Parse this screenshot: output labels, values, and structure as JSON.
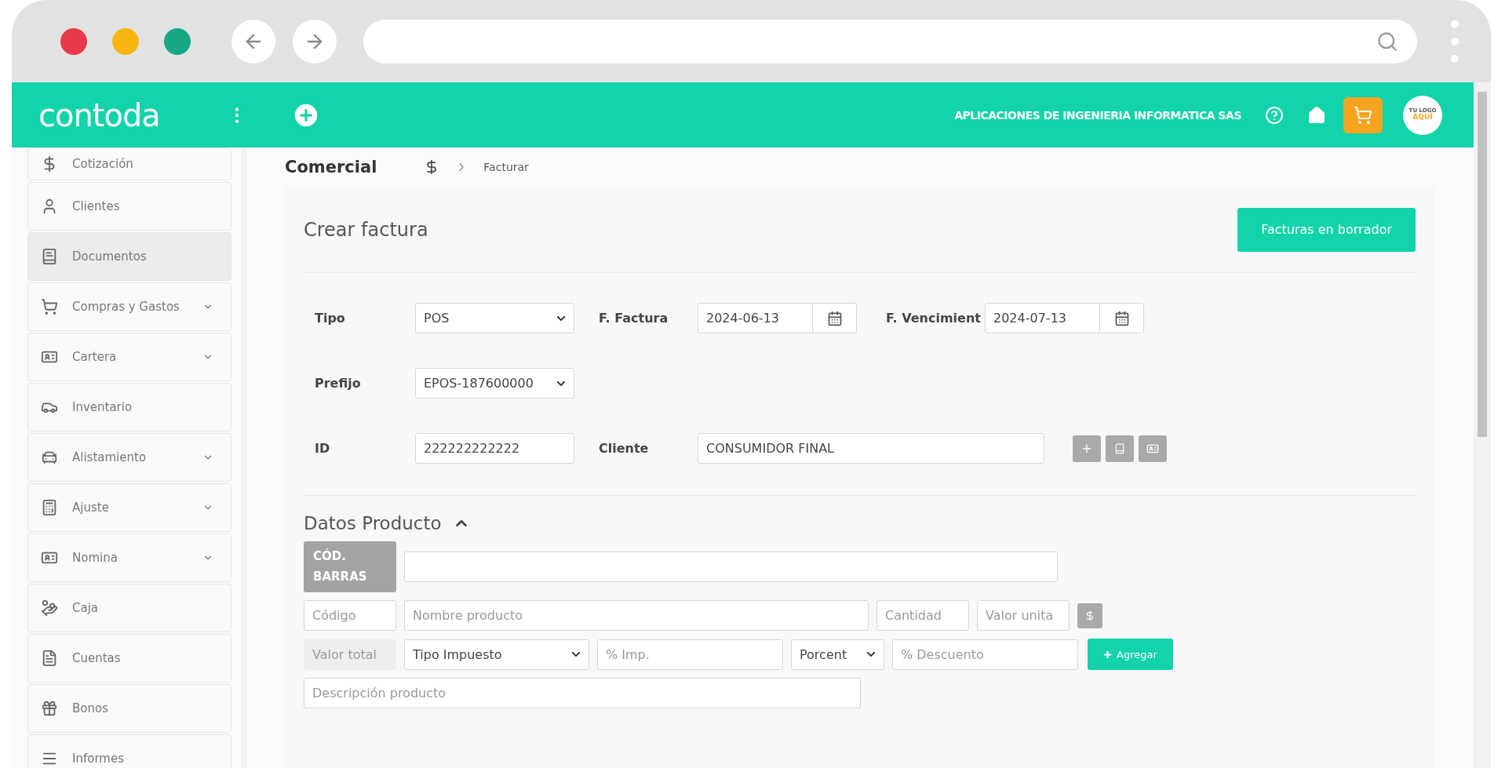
{
  "header": {
    "logo": "contoda",
    "company": "APLICACIONES DE INGENIERIA INFORMATICA SAS",
    "logo_badge": [
      "TU LOGO",
      "AQUÍ"
    ]
  },
  "sidebar": {
    "items": [
      {
        "label": "Cotización",
        "selected": false,
        "submenu": false
      },
      {
        "label": "Clientes",
        "selected": false,
        "submenu": false
      },
      {
        "label": "Documentos",
        "selected": true,
        "submenu": false
      },
      {
        "label": "Compras y Gastos",
        "selected": false,
        "submenu": true
      },
      {
        "label": "Cartera",
        "selected": false,
        "submenu": true
      },
      {
        "label": "Inventario",
        "selected": false,
        "submenu": false
      },
      {
        "label": "Alistamiento",
        "selected": false,
        "submenu": true
      },
      {
        "label": "Ajuste",
        "selected": false,
        "submenu": true
      },
      {
        "label": "Nomina",
        "selected": false,
        "submenu": true
      },
      {
        "label": "Caja",
        "selected": false,
        "submenu": false
      },
      {
        "label": "Cuentas",
        "selected": false,
        "submenu": false
      },
      {
        "label": "Bonos",
        "selected": false,
        "submenu": false
      },
      {
        "label": "Informes",
        "selected": false,
        "submenu": false
      }
    ]
  },
  "breadcrumb": {
    "title": "Comercial",
    "current": "Facturar"
  },
  "card": {
    "title": "Crear factura",
    "draft_button": "Facturas en borrador"
  },
  "form": {
    "tipo_label": "Tipo",
    "tipo": "POS",
    "fecha_label": "F. Factura",
    "fecha": "2024-06-13",
    "venc_label": "F. Vencimient",
    "venc": "2024-07-13",
    "prefijo_label": "Prefijo",
    "prefijo": "EPOS-187600000",
    "id_label": "ID",
    "id": "222222222222",
    "cliente_label": "Cliente",
    "cliente": "CONSUMIDOR FINAL"
  },
  "product": {
    "title": "Datos Producto",
    "expanded": true,
    "barcode_label": [
      "CÓD.",
      "BARRAS"
    ],
    "codigo": {
      "placeholder": "Código"
    },
    "nombre": {
      "placeholder": "Nombre producto"
    },
    "cantidad": {
      "placeholder": "Cantidad"
    },
    "valor_unitario": {
      "placeholder": "Valor unita"
    },
    "valor_total": {
      "placeholder": "Valor total",
      "disabled": true
    },
    "tipo_impuesto": "Tipo Impuesto",
    "imp": {
      "placeholder": "% Imp."
    },
    "descuento_tipo": "Porcent",
    "descuento": {
      "placeholder": "% Descuento"
    },
    "add_button": "Agregar",
    "descripcion": {
      "placeholder": "Descripción producto"
    }
  }
}
